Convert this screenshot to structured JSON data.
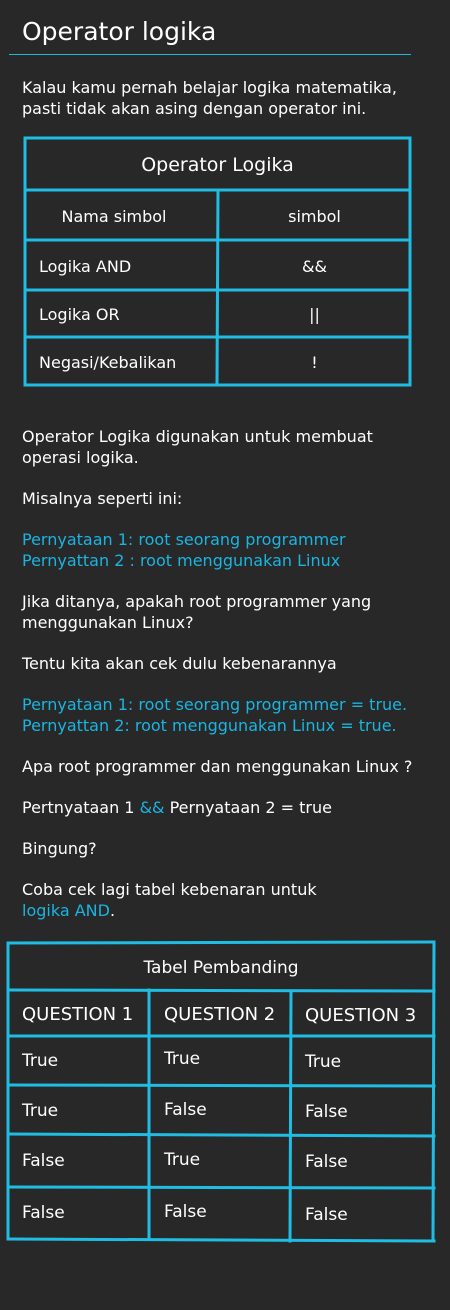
{
  "title": "Operator logika",
  "intro": [
    "Kalau kamu pernah belajar logika matematika,",
    "pasti tidak akan asing dengan operator ini."
  ],
  "table1": {
    "caption": "Operator Logika",
    "headers": [
      "Nama simbol",
      "simbol"
    ],
    "rows": [
      [
        "Logika  AND",
        "&&"
      ],
      [
        "Logika OR",
        "||"
      ],
      [
        "Negasi/Kebalikan",
        "!"
      ]
    ]
  },
  "p_operator": [
    "Operator Logika digunakan untuk membuat",
    "operasi logika."
  ],
  "p_misalnya": "Misalnya seperti ini:",
  "statements1": [
    "Pernyataan 1: root seorang programmer",
    "Pernyattan 2 : root menggunakan Linux"
  ],
  "p_jika": [
    "Jika ditanya, apakah root programmer yang",
    "menggunakan Linux?"
  ],
  "p_tentu": "Tentu kita akan cek dulu kebenarannya",
  "statements2": [
    "Pernyataan 1: root seorang programmer = true.",
    "Pernyattan 2: root menggunakan Linux = true."
  ],
  "p_apa": "Apa root programmer dan menggunakan Linux ?",
  "p_expr": {
    "left": "Pertnyataan 1 ",
    "op": "&&",
    "right": " Pernyataan 2 = true"
  },
  "p_bingung": "Bingung?",
  "p_coba": {
    "line1": "Coba cek lagi tabel kebenaran untuk",
    "link": "logika AND",
    "tail": "."
  },
  "table2": {
    "caption": "Tabel Pembanding",
    "headers": [
      "QUESTION 1",
      "QUESTION 2",
      "QUESTION 3"
    ],
    "rows": [
      [
        "True",
        "True",
        "True"
      ],
      [
        "True",
        "False",
        "False"
      ],
      [
        "False",
        "True",
        "False"
      ],
      [
        "False",
        "False",
        "False"
      ]
    ]
  },
  "colors": {
    "background": "#282828",
    "text": "#ffffff",
    "accent": "#19b5e2",
    "border": "#1fbde3"
  }
}
